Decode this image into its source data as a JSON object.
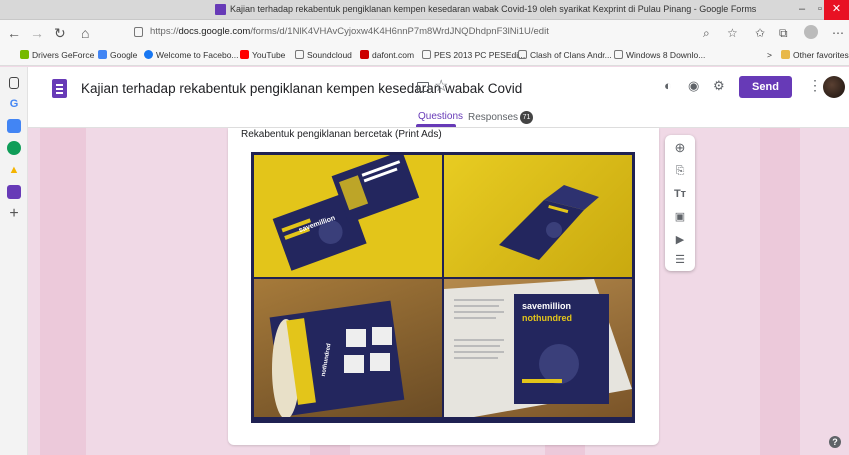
{
  "window": {
    "title": "Kajian terhadap rekabentuk pengiklanan kempen kesedaran wabak Covid-19 oleh syarikat Kexprint di Pulau Pinang - Google Forms"
  },
  "browser": {
    "url_prefix": "https://",
    "url_domain": "docs.google.com",
    "url_path": "/forms/d/1NlK4VHAvCyjoxw4K4H6nnP7m8WrdJNQDhdpnF3lNi1U/edit",
    "bookmarks": [
      {
        "label": "Drivers GeForce",
        "color": "#76b900"
      },
      {
        "label": "Google",
        "color": "#4285f4"
      },
      {
        "label": "Welcome to Facebo...",
        "color": "#1877f2"
      },
      {
        "label": "YouTube",
        "color": "#ff0000"
      },
      {
        "label": "Soundcloud",
        "color": "#ffffff"
      },
      {
        "label": "dafont.com",
        "color": "#cc0000"
      },
      {
        "label": "PES 2013 PC PESEdi...",
        "color": "#ffffff"
      },
      {
        "label": "Clash of Clans Andr...",
        "color": "#ffffff"
      },
      {
        "label": "Windows 8 Downlo...",
        "color": "#ffffff"
      }
    ],
    "other_favorites": "Other favorites",
    "chevron": ">"
  },
  "forms": {
    "title": "Kajian terhadap rekabentuk pengiklanan kempen kesedaran wabak Covid",
    "send_label": "Send",
    "tabs": [
      {
        "label": "Questions"
      },
      {
        "label": "Responses",
        "badge": "71"
      }
    ],
    "question_title": "Rekabentuk pengiklanan bercetak (Print Ads)",
    "image_text": [
      "savemillion",
      "nothundred"
    ]
  },
  "toolbar_icons": [
    "add-question-icon",
    "import-questions-icon",
    "add-title-icon",
    "add-image-icon",
    "add-video-icon",
    "add-section-icon"
  ],
  "colors": {
    "accent": "#673ab7",
    "background": "#f0d9e6",
    "stripe": "#ecc9da",
    "print_navy": "#1f2152",
    "print_yellow": "#e3c51a"
  }
}
